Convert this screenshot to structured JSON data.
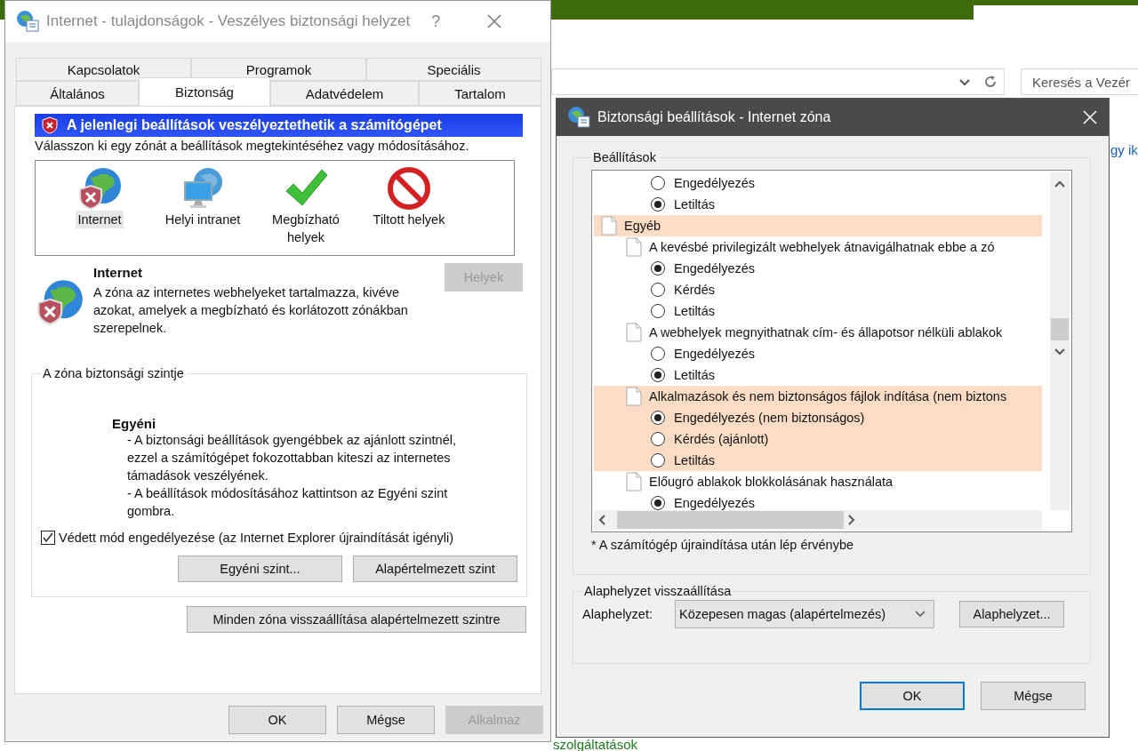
{
  "background": {
    "search": {
      "placeholder": "Keresés a Vezér"
    },
    "link_fragment": "gy ik",
    "footer_link": "szolgáltatások"
  },
  "options": {
    "title": "Internet - tulajdonságok - Veszélyes biztonsági helyzet",
    "help": "?",
    "tab_rows": [
      [
        {
          "label": "Kapcsolatok",
          "selected": false
        },
        {
          "label": "Programok",
          "selected": false
        },
        {
          "label": "Speciális",
          "selected": false
        }
      ],
      [
        {
          "label": "Általános",
          "selected": false
        },
        {
          "label": "Biztonság",
          "selected": true
        },
        {
          "label": "Adatvédelem",
          "selected": false
        },
        {
          "label": "Tartalom",
          "selected": false
        }
      ]
    ],
    "warning": "A jelenlegi beállítások veszélyeztethetik a számítógépet",
    "zone_prompt": "Válasszon ki egy zónát a beállítások megtekintéséhez vagy módosításához.",
    "zones": [
      {
        "label": "Internet",
        "kind": "internet",
        "selected": true
      },
      {
        "label": "Helyi intranet",
        "kind": "intranet",
        "selected": false
      },
      {
        "label": "Megbízható helyek",
        "kind": "trusted",
        "selected": false
      },
      {
        "label": "Tiltott helyek",
        "kind": "restricted",
        "selected": false
      }
    ],
    "zone_info": {
      "name": "Internet",
      "description": "A zóna az internetes webhelyeket tartalmazza, kivéve azokat, amelyek a megbízható és korlátozott zónákban szerepelnek.",
      "sites_button": {
        "label": "Helyek",
        "disabled": true
      }
    },
    "level_group": {
      "legend": "A zóna biztonsági szintje",
      "level_name": "Egyéni",
      "lines": [
        "- A biztonsági beállítások gyengébbek az ajánlott szintnél,",
        "ezzel a számítógépet fokozottabban kiteszi az internetes",
        "támadások veszélyének.",
        "- A beállítások módosításához kattintson az Egyéni szint",
        "gombra."
      ],
      "protected_mode": {
        "label": "Védett mód engedélyezése (az Internet Explorer újraindítását igényli)",
        "checked": true
      },
      "buttons": [
        "Egyéni szint...",
        "Alapértelmezett szint"
      ]
    },
    "reset_all": "Minden zóna visszaállítása alapértelmezett szintre",
    "footer_buttons": [
      {
        "label": "OK",
        "disabled": false
      },
      {
        "label": "Mégse",
        "disabled": false
      },
      {
        "label": "Alkalmaz",
        "disabled": true
      }
    ]
  },
  "settings": {
    "title": "Biztonsági beállítások - Internet zóna",
    "legend": "Beállítások",
    "rows": [
      {
        "kind": "radio",
        "label": "Engedélyezés",
        "selected": false,
        "highlighted": false
      },
      {
        "kind": "radio",
        "label": "Letiltás",
        "selected": true,
        "highlighted": false
      },
      {
        "kind": "category",
        "label": "Egyéb",
        "highlighted": true
      },
      {
        "kind": "setting",
        "label": "A kevésbé privilegizált webhelyek átnavigálhatnak ebbe a zó",
        "highlighted": false
      },
      {
        "kind": "radio",
        "label": "Engedélyezés",
        "selected": true,
        "highlighted": false
      },
      {
        "kind": "radio",
        "label": "Kérdés",
        "selected": false,
        "highlighted": false
      },
      {
        "kind": "radio",
        "label": "Letiltás",
        "selected": false,
        "highlighted": false
      },
      {
        "kind": "setting",
        "label": "A webhelyek megnyithatnak cím- és állapotsor nélküli ablakok",
        "highlighted": false
      },
      {
        "kind": "radio",
        "label": "Engedélyezés",
        "selected": false,
        "highlighted": false
      },
      {
        "kind": "radio",
        "label": "Letiltás",
        "selected": true,
        "highlighted": false
      },
      {
        "kind": "setting",
        "label": "Alkalmazások és nem biztonságos fájlok indítása (nem biztons",
        "highlighted": true
      },
      {
        "kind": "radio",
        "label": "Engedélyezés (nem biztonságos)",
        "selected": true,
        "highlighted": true
      },
      {
        "kind": "radio",
        "label": "Kérdés (ajánlott)",
        "selected": false,
        "highlighted": true
      },
      {
        "kind": "radio",
        "label": "Letiltás",
        "selected": false,
        "highlighted": true
      },
      {
        "kind": "setting",
        "label": "Előugró ablakok blokkolásának használata",
        "highlighted": false
      },
      {
        "kind": "radio",
        "label": "Engedélyezés",
        "selected": true,
        "highlighted": false
      }
    ],
    "note": "* A számítógép újraindítása után lép érvénybe",
    "reset_legend": "Alaphelyzet visszaállítása",
    "reset_label": "Alaphelyzet:",
    "reset_value": "Közepesen magas (alapértelmezés)",
    "reset_button": "Alaphelyzet...",
    "buttons": [
      {
        "label": "OK",
        "default": true
      },
      {
        "label": "Mégse",
        "default": false
      }
    ]
  }
}
